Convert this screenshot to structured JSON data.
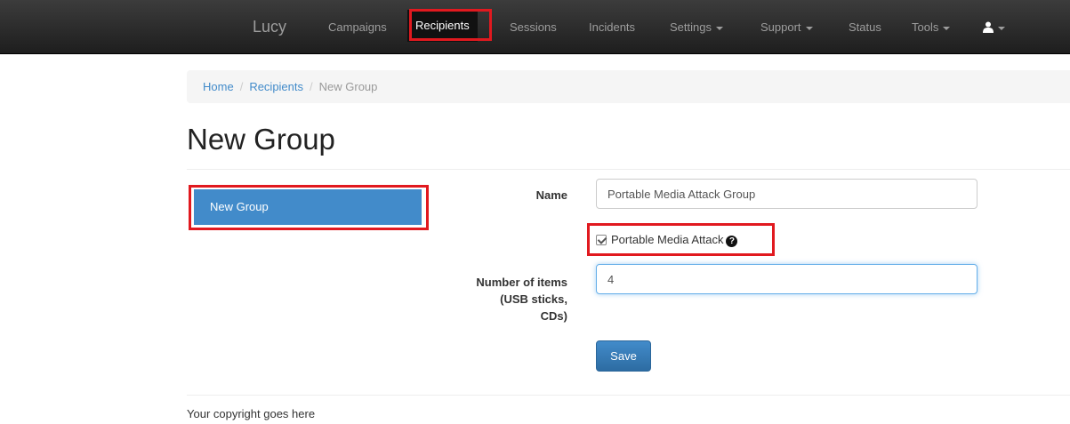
{
  "navbar": {
    "brand": "Lucy",
    "items": [
      {
        "label": "Campaigns"
      },
      {
        "label": "Recipients"
      },
      {
        "label": "Sessions"
      },
      {
        "label": "Incidents"
      },
      {
        "label": "Settings"
      },
      {
        "label": "Support"
      },
      {
        "label": "Status"
      },
      {
        "label": "Tools"
      }
    ],
    "active_item": "Recipients",
    "user_icon": "user-icon"
  },
  "breadcrumb": {
    "items": [
      "Home",
      "Recipients"
    ],
    "current": "New Group",
    "separator": "/"
  },
  "page": {
    "title": "New Group"
  },
  "sidebar": {
    "group_label": "New Group"
  },
  "form": {
    "name_label": "Name",
    "name_value": "Portable Media Attack Group",
    "checkbox_label": "Portable Media Attack",
    "checkbox_checked": true,
    "help_icon": "question-circle-icon",
    "items_label_line1": "Number of items",
    "items_label_line2": "(USB sticks,",
    "items_label_line3": "CDs)",
    "items_value": "4",
    "save_label": "Save"
  },
  "footer": {
    "text": "Your copyright goes here"
  },
  "colors": {
    "accent": "#428bca",
    "highlight": "#e1191f",
    "navbar": "#222222"
  }
}
